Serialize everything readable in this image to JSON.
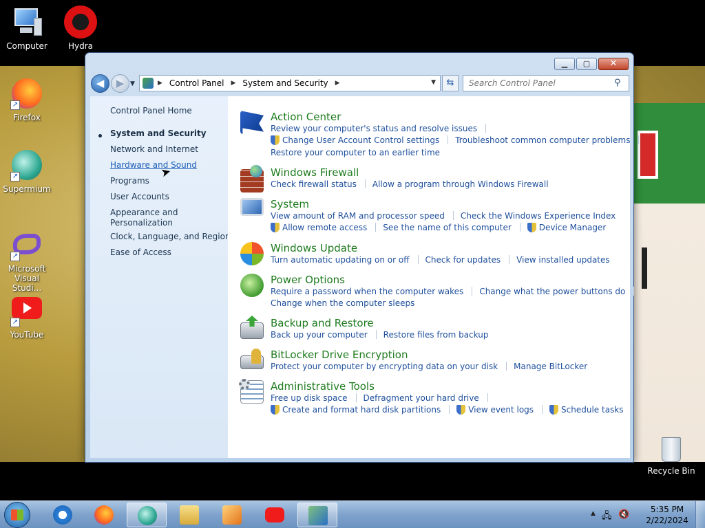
{
  "desktop": {
    "icons": [
      {
        "label": "Computer"
      },
      {
        "label": "Hydra"
      },
      {
        "label": "Firefox"
      },
      {
        "label": "Supermium"
      },
      {
        "label": "Microsoft Visual Studi..."
      },
      {
        "label": "YouTube"
      },
      {
        "label": "Recycle Bin"
      }
    ]
  },
  "window": {
    "controls": {
      "minimize": "▁",
      "maximize": "▢",
      "close": "✕"
    },
    "breadcrumb": [
      "Control Panel",
      "System and Security"
    ],
    "search_placeholder": "Search Control Panel"
  },
  "leftnav": {
    "home": "Control Panel Home",
    "items": [
      {
        "label": "System and Security"
      },
      {
        "label": "Network and Internet"
      },
      {
        "label": "Hardware and Sound"
      },
      {
        "label": "Programs"
      },
      {
        "label": "User Accounts"
      },
      {
        "label": "Appearance and"
      },
      {
        "label": "Personalization"
      },
      {
        "label": "Clock, Language, and Region"
      },
      {
        "label": "Ease of Access"
      }
    ]
  },
  "categories": [
    {
      "title": "Action Center",
      "rows": [
        [
          "Review your computer's status and resolve issues"
        ],
        [
          "Change User Account Control settings",
          "Troubleshoot common computer problems"
        ],
        [
          "Restore your computer to an earlier time"
        ]
      ]
    },
    {
      "title": "Windows Firewall",
      "rows": [
        [
          "Check firewall status",
          "Allow a program through Windows Firewall"
        ]
      ]
    },
    {
      "title": "System",
      "rows": [
        [
          "View amount of RAM and processor speed",
          "Check the Windows Experience Index"
        ],
        [
          "Allow remote access",
          "See the name of this computer",
          "Device Manager"
        ]
      ]
    },
    {
      "title": "Windows Update",
      "rows": [
        [
          "Turn automatic updating on or off",
          "Check for updates",
          "View installed updates"
        ]
      ]
    },
    {
      "title": "Power Options",
      "rows": [
        [
          "Require a password when the computer wakes",
          "Change what the power buttons do"
        ],
        [
          "Change when the computer sleeps"
        ]
      ]
    },
    {
      "title": "Backup and Restore",
      "rows": [
        [
          "Back up your computer",
          "Restore files from backup"
        ]
      ]
    },
    {
      "title": "BitLocker Drive Encryption",
      "rows": [
        [
          "Protect your computer by encrypting data on your disk",
          "Manage BitLocker"
        ]
      ]
    },
    {
      "title": "Administrative Tools",
      "rows": [
        [
          "Free up disk space",
          "Defragment your hard drive"
        ],
        [
          "Create and format hard disk partitions",
          "View event logs",
          "Schedule tasks"
        ]
      ]
    }
  ],
  "taskbar": {
    "clock_time": "5:35 PM",
    "clock_date": "2/22/2024"
  },
  "colors": {
    "category_title": "#1e7b1e",
    "link": "#1e4f9c",
    "hover_link": "#1e5fb6"
  }
}
